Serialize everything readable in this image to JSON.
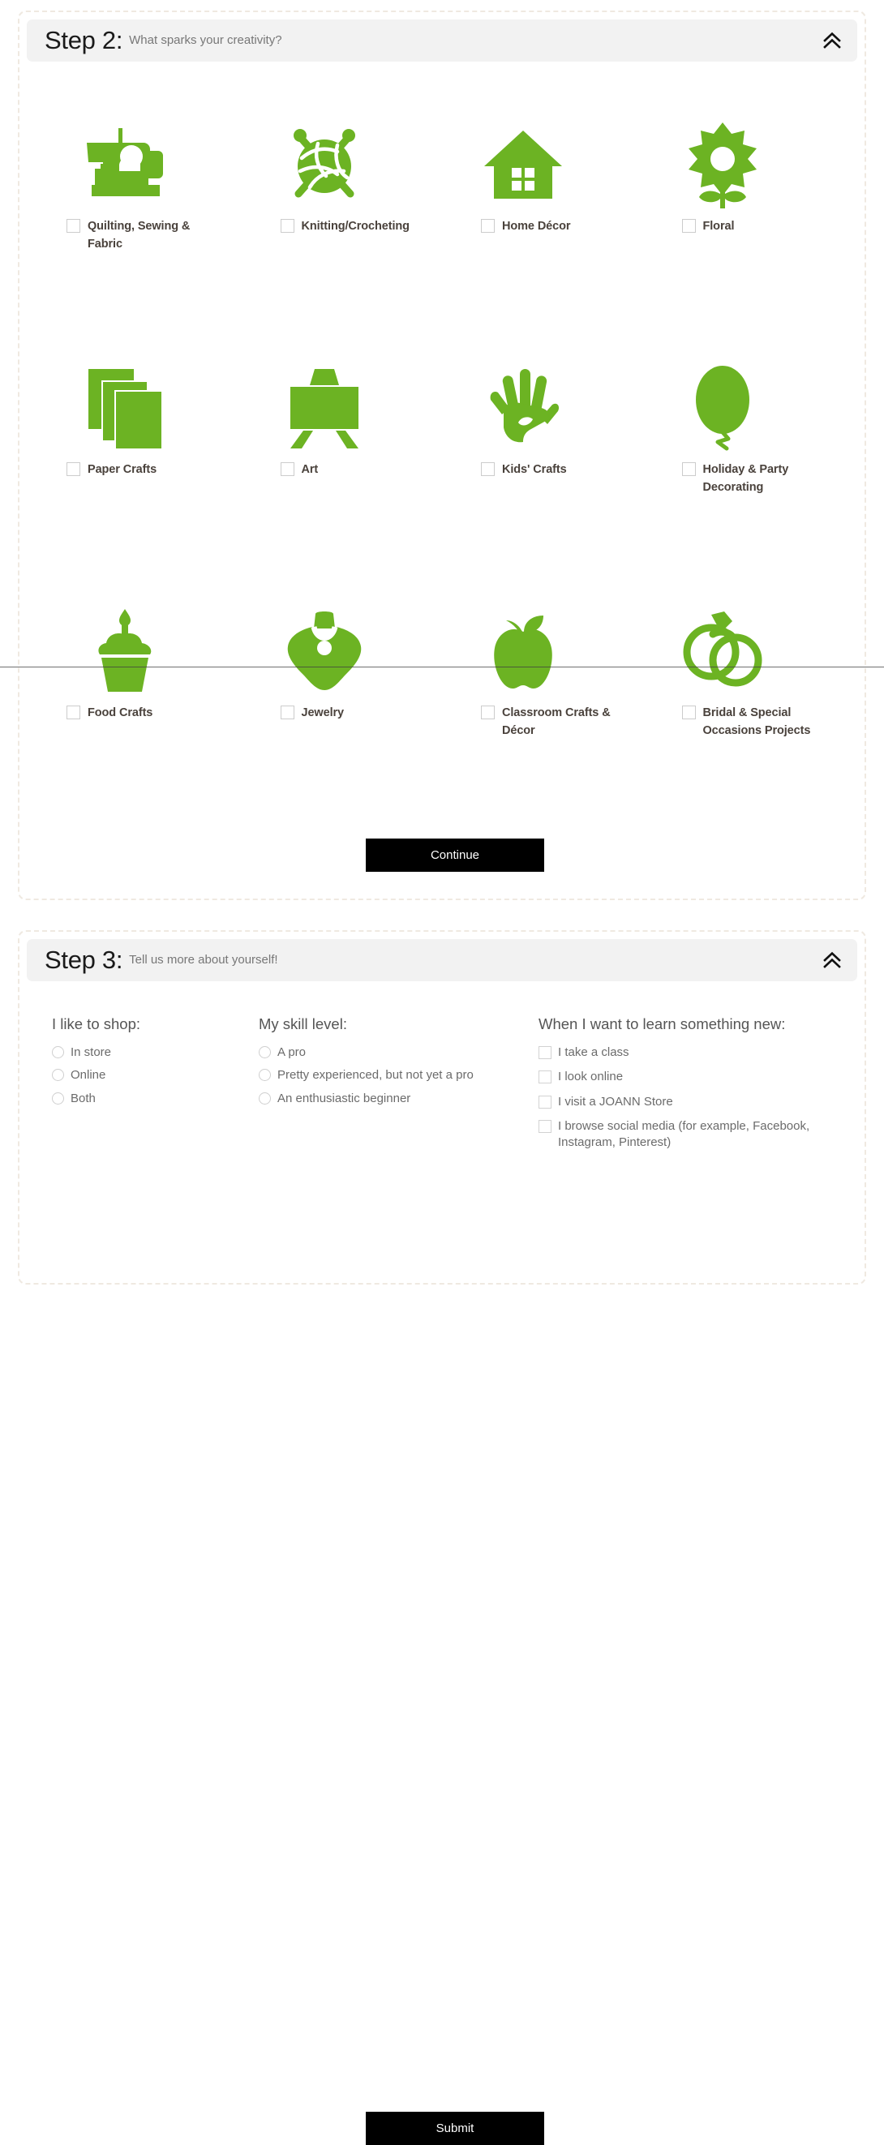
{
  "accent_green": "#6cb323",
  "panel_border": "#efe9e1",
  "header_bg": "#f2f2f2",
  "step2": {
    "title": "Step 2:",
    "subtitle": "What sparks your creativity?",
    "collapse_icon": "double-chevron-up-icon",
    "continue_label": "Continue",
    "options": [
      {
        "label": "Quilting, Sewing & Fabric",
        "icon": "sewing-machine-icon",
        "checked": false
      },
      {
        "label": "Knitting/Crocheting",
        "icon": "yarn-ball-needles-icon",
        "checked": false
      },
      {
        "label": "Home Décor",
        "icon": "house-icon",
        "checked": false
      },
      {
        "label": "Floral",
        "icon": "flower-icon",
        "checked": false
      },
      {
        "label": "Paper Crafts",
        "icon": "paper-stack-icon",
        "checked": false
      },
      {
        "label": "Art",
        "icon": "easel-icon",
        "checked": false
      },
      {
        "label": "Kids' Crafts",
        "icon": "handprint-icon",
        "checked": false
      },
      {
        "label": "Holiday & Party Decorating",
        "icon": "balloon-icon",
        "checked": false
      },
      {
        "label": "Food Crafts",
        "icon": "cupcake-icon",
        "checked": false
      },
      {
        "label": "Jewelry",
        "icon": "necklace-icon",
        "checked": false
      },
      {
        "label": "Classroom Crafts & Décor",
        "icon": "apple-icon",
        "checked": false
      },
      {
        "label": "Bridal & Special Occasions Projects",
        "icon": "wedding-rings-icon",
        "checked": false
      }
    ]
  },
  "step3": {
    "title": "Step 3:",
    "subtitle": "Tell us more about yourself!",
    "collapse_icon": "double-chevron-up-icon",
    "submit_label": "Submit",
    "columns": [
      {
        "heading": "I like to shop:",
        "type": "radio",
        "options": [
          {
            "label": "In store",
            "selected": false
          },
          {
            "label": "Online",
            "selected": false
          },
          {
            "label": "Both",
            "selected": false
          }
        ]
      },
      {
        "heading": "My skill level:",
        "type": "radio",
        "options": [
          {
            "label": "A pro",
            "selected": false
          },
          {
            "label": "Pretty experienced, but not yet a pro",
            "selected": false
          },
          {
            "label": "An enthusiastic beginner",
            "selected": false
          }
        ]
      },
      {
        "heading": "When I want to learn something new:",
        "type": "checkbox",
        "options": [
          {
            "label": "I take a class",
            "selected": false
          },
          {
            "label": "I look online",
            "selected": false
          },
          {
            "label": "I visit a JOANN Store",
            "selected": false
          },
          {
            "label": "I browse social media (for example, Facebook, Instagram, Pinterest)",
            "selected": false
          }
        ]
      }
    ]
  }
}
